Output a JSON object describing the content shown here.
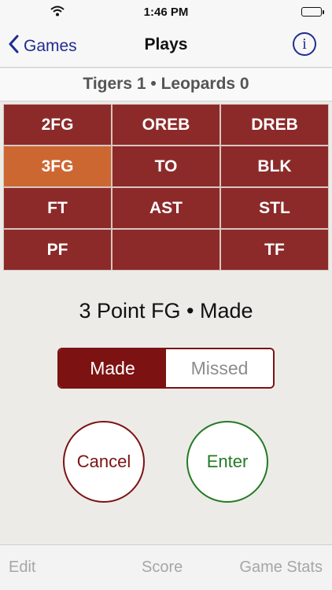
{
  "status": {
    "time": "1:46 PM"
  },
  "nav": {
    "back_label": "Games",
    "title": "Plays",
    "info_glyph": "i"
  },
  "score": {
    "text": "Tigers 1 • Leopards 0"
  },
  "plays": [
    {
      "label": "2FG",
      "selected": false
    },
    {
      "label": "OREB",
      "selected": false
    },
    {
      "label": "DREB",
      "selected": false
    },
    {
      "label": "3FG",
      "selected": true
    },
    {
      "label": "TO",
      "selected": false
    },
    {
      "label": "BLK",
      "selected": false
    },
    {
      "label": "FT",
      "selected": false
    },
    {
      "label": "AST",
      "selected": false
    },
    {
      "label": "STL",
      "selected": false
    },
    {
      "label": "PF",
      "selected": false
    },
    {
      "label": "",
      "selected": false
    },
    {
      "label": "TF",
      "selected": false
    }
  ],
  "play_description": "3 Point FG • Made",
  "result_toggle": {
    "options": [
      "Made",
      "Missed"
    ],
    "selected": "Made"
  },
  "actions": {
    "cancel_label": "Cancel",
    "enter_label": "Enter"
  },
  "tabs": {
    "edit": "Edit",
    "score": "Score",
    "stats": "Game Stats"
  },
  "colors": {
    "maroon": "#8c2a2a",
    "selected_orange": "#cd6732",
    "nav_blue": "#1f2d8f",
    "enter_green": "#237a23",
    "tab_gray": "#a6a6a6"
  }
}
